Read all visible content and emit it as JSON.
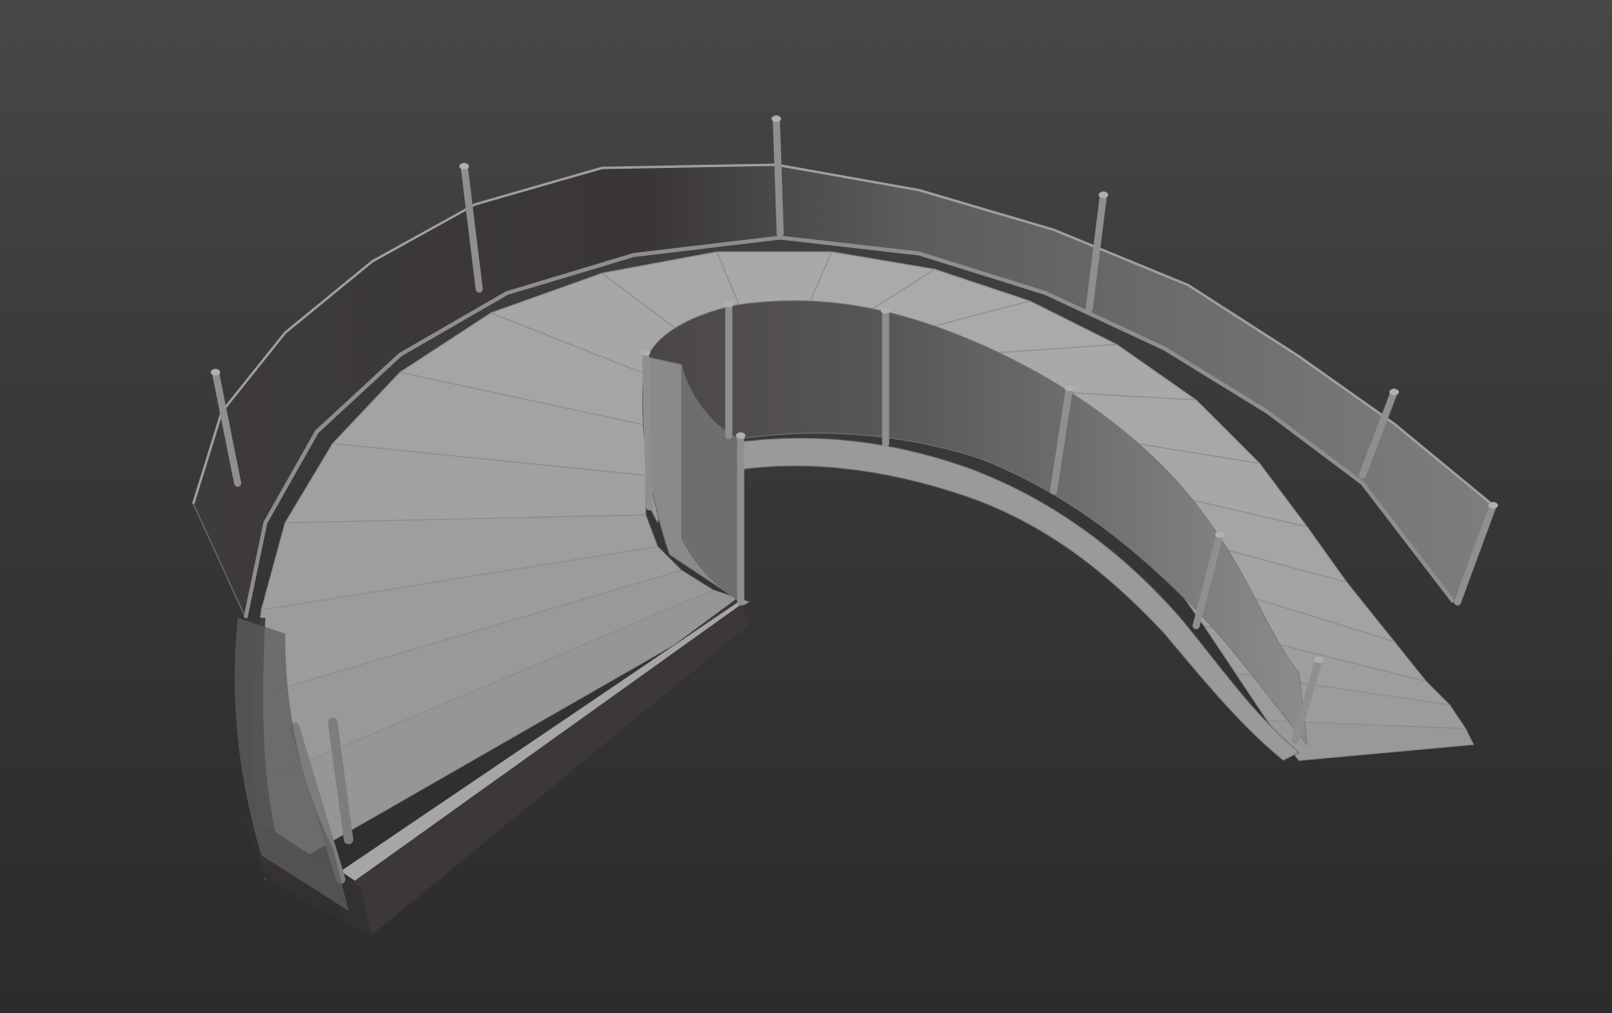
{
  "scene": {
    "subject": "staircase-model",
    "colors": {
      "background_top": "#474747",
      "background_bottom": "#2b2b2b",
      "tread": "#a6a6a6",
      "tread_edge": "#8c8c8c",
      "stringer_dark": "#3a3838",
      "panel_far": "#4a4646",
      "panel_near": "#8a8a8a",
      "post": "#8f8f8f"
    }
  }
}
